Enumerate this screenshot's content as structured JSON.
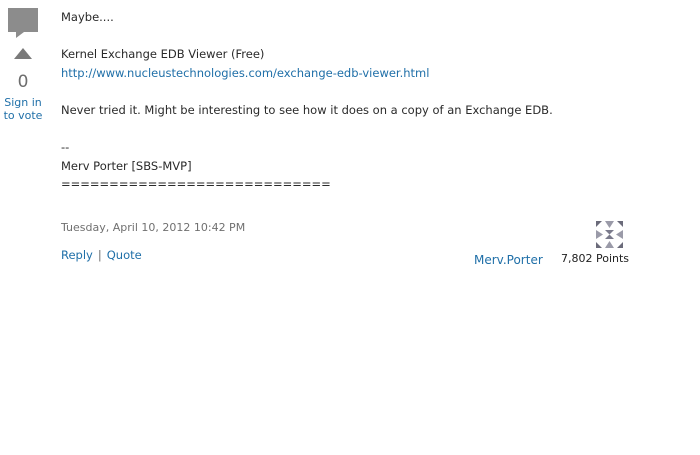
{
  "vote": {
    "count": "0",
    "sign_in_line1": "Sign in",
    "sign_in_line2": "to vote"
  },
  "post": {
    "opening": "Maybe....",
    "product_title": "Kernel Exchange EDB Viewer (Free)",
    "product_url": "http://www.nucleustechnologies.com/exchange-edb-viewer.html",
    "comment": "Never tried it.  Might be interesting to see how it does on a copy of an Exchange EDB.",
    "sig_dashes": "--",
    "sig_name": "Merv  Porter  [SBS-MVP]",
    "sig_rule": "============================"
  },
  "meta": {
    "timestamp": "Tuesday, April 10, 2012 10:42 PM"
  },
  "actions": {
    "reply_label": "Reply",
    "separator": "|",
    "quote_label": "Quote"
  },
  "author": {
    "name": "Merv.Porter",
    "points": "7,802 Points",
    "avatar_icon": "identicon-avatar-icon"
  },
  "colors": {
    "link": "#1f6fa8",
    "vote_arrow": "#7a7a7a",
    "bubble": "#8c8c8c"
  }
}
